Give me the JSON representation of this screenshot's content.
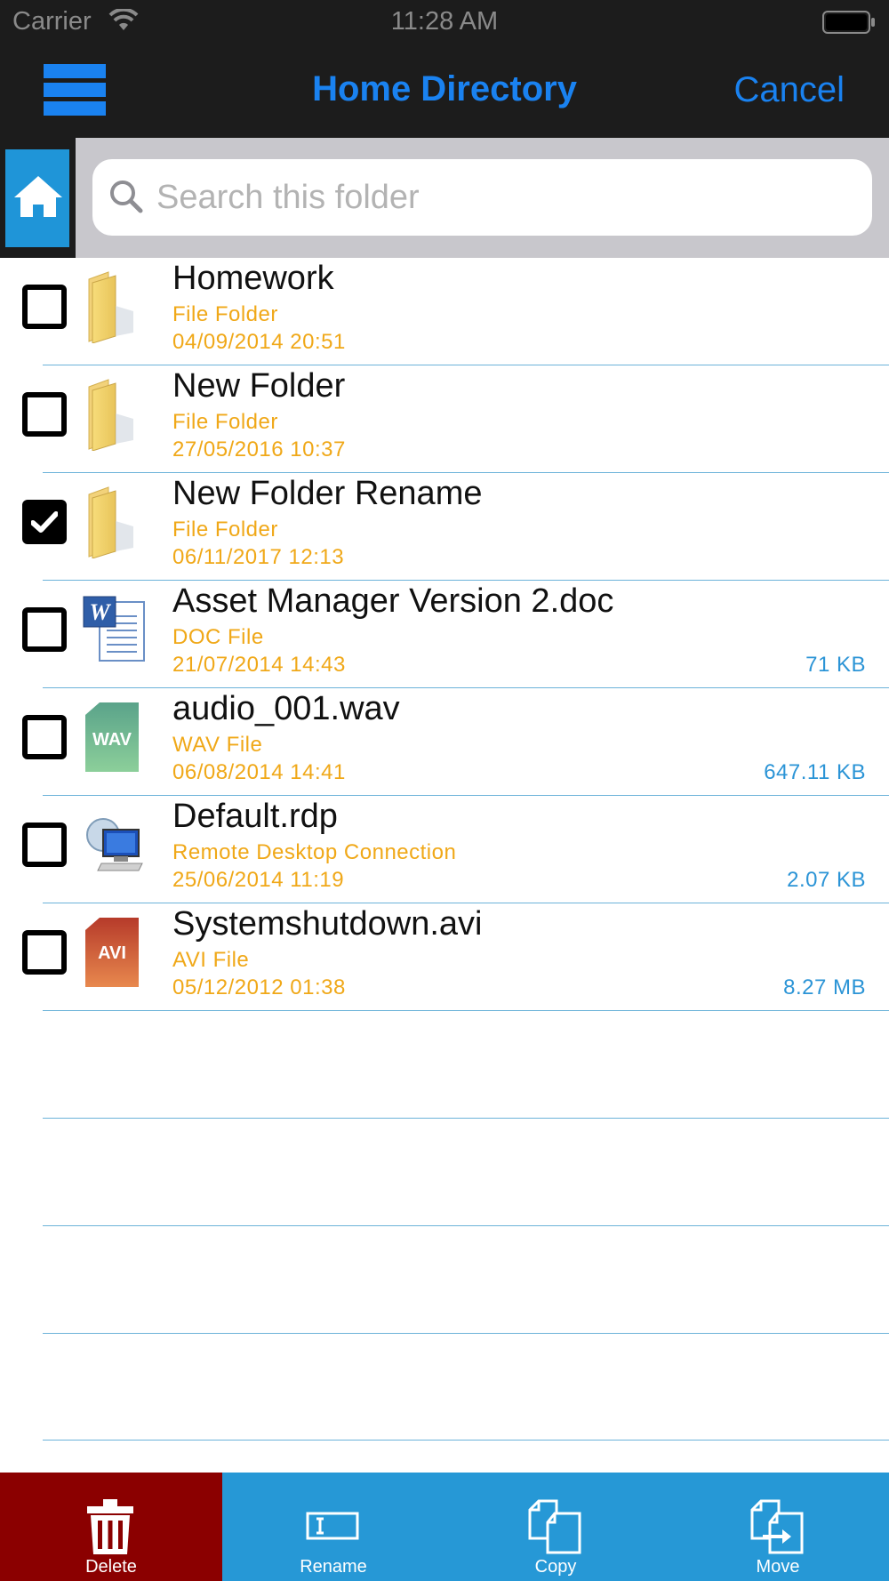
{
  "status_bar": {
    "carrier": "Carrier",
    "time": "11:28 AM",
    "wifi_icon": "wifi-icon",
    "battery_icon": "battery-icon"
  },
  "nav": {
    "menu_icon": "hamburger-menu-icon",
    "title": "Home Directory",
    "cancel_label": "Cancel",
    "accent_color": "#1a82f0"
  },
  "search": {
    "home_icon": "home-icon",
    "search_icon": "search-icon",
    "placeholder": "Search this folder",
    "value": ""
  },
  "files": [
    {
      "name": "Homework",
      "type": "File Folder",
      "date": "04/09/2014 20:51",
      "size": "",
      "icon": "folder-icon",
      "checked": false
    },
    {
      "name": "New Folder",
      "type": "File Folder",
      "date": "27/05/2016 10:37",
      "size": "",
      "icon": "folder-icon",
      "checked": false
    },
    {
      "name": "New Folder Rename",
      "type": "File Folder",
      "date": "06/11/2017 12:13",
      "size": "",
      "icon": "folder-icon",
      "checked": true
    },
    {
      "name": "Asset Manager Version 2.doc",
      "type": "DOC File",
      "date": "21/07/2014 14:43",
      "size": "71 KB",
      "icon": "word-doc-icon",
      "checked": false
    },
    {
      "name": "audio_001.wav",
      "type": "WAV File",
      "date": "06/08/2014 14:41",
      "size": "647.11 KB",
      "icon": "wav-file-icon",
      "icon_text": "WAV",
      "checked": false
    },
    {
      "name": "Default.rdp",
      "type": "Remote Desktop Connection",
      "date": "25/06/2014 11:19",
      "size": "2.07 KB",
      "icon": "remote-desktop-icon",
      "checked": false
    },
    {
      "name": "Systemshutdown.avi",
      "type": "AVI File",
      "date": "05/12/2012 01:38",
      "size": "8.27 MB",
      "icon": "avi-file-icon",
      "icon_text": "AVI",
      "checked": false
    }
  ],
  "colors": {
    "meta_text": "#f0a818",
    "size_text": "#2b94d6",
    "separator": "#6cb3d9",
    "toolbar": "#2698d6",
    "delete": "#8b0000"
  },
  "toolbar": {
    "delete_label": "Delete",
    "rename_label": "Rename",
    "copy_label": "Copy",
    "move_label": "Move",
    "delete_icon": "trash-icon",
    "rename_icon": "rename-icon",
    "copy_icon": "copy-icon",
    "move_icon": "move-icon"
  }
}
